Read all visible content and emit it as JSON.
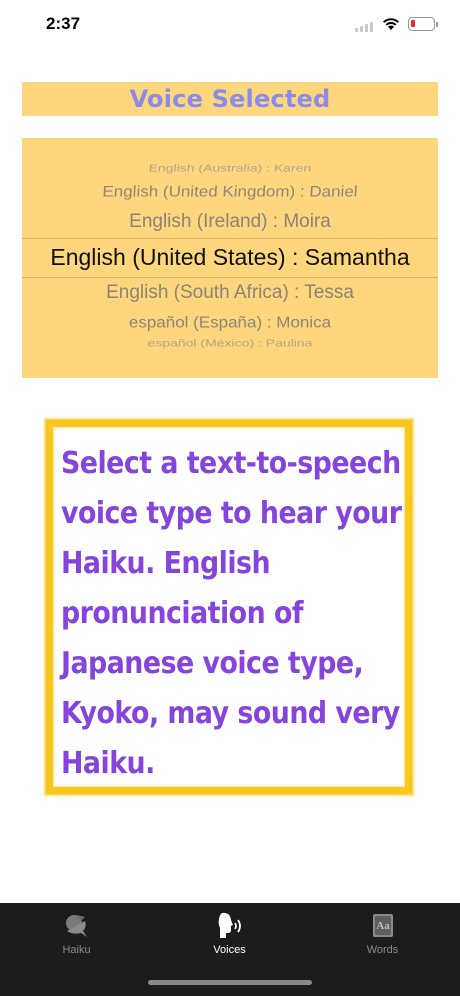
{
  "status_bar": {
    "time": "2:37",
    "battery_color": "#e0302a"
  },
  "voice_header": {
    "label": "Voice Selected",
    "bg_color": "#fdd67e",
    "text_color": "#8a8bea"
  },
  "picker": {
    "bg_color": "#fdd67e",
    "items": [
      "English (Australia) : Karen",
      "English (United Kingdom) : Daniel",
      "English (Ireland) : Moira",
      "English (United States) : Samantha",
      "English (South Africa) : Tessa",
      "español (España) : Monica",
      "español (México) : Paulina"
    ],
    "selected_value": "English (United States) : Samantha"
  },
  "info_box": {
    "text": "Select a text-to-speech voice type to hear your Haiku. English pronunciation of Japanese voice type, Kyoko, may sound very Haiku.",
    "text_color": "#8545dd",
    "border_color": "#f7c81f"
  },
  "tab_bar": {
    "tabs": [
      {
        "label": "Haiku",
        "icon": "haiku-icon",
        "selected": false
      },
      {
        "label": "Voices",
        "icon": "speaking-head-icon",
        "selected": true
      },
      {
        "label": "Words",
        "icon": "dictionary-icon",
        "selected": false
      }
    ],
    "bg_color": "#1c1c1c"
  }
}
